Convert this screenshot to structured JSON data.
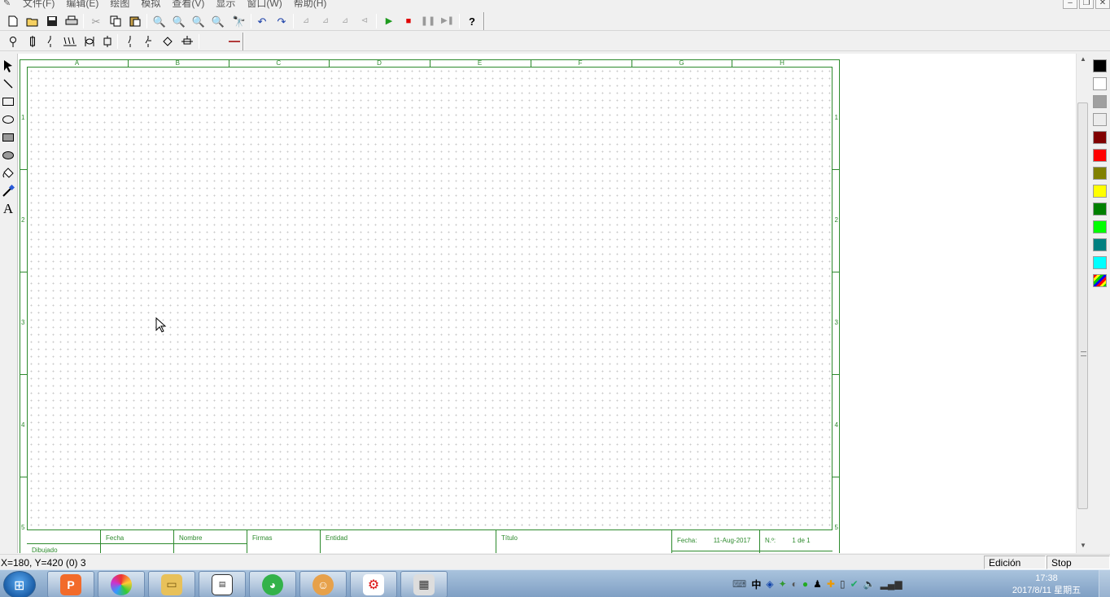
{
  "menubar": {
    "items": [
      "文件(F)",
      "编辑(E)",
      "绘图",
      "模拟",
      "查看(V)",
      "显示",
      "窗口(W)",
      "帮助(H)"
    ]
  },
  "toolbar1": {
    "icons": [
      "new-file-icon",
      "open-folder-icon",
      "save-icon",
      "print-icon",
      "cut-icon",
      "copy-icon",
      "paste-icon",
      "zoom-icon",
      "zoom-out-icon",
      "zoom-area-icon",
      "zoom-fit-icon",
      "find-icon",
      "undo-icon",
      "redo-icon",
      "mirror-h-icon",
      "mirror-v-icon",
      "rotate-left-icon",
      "rotate-right-icon",
      "run-icon",
      "stop-icon",
      "pause-icon",
      "step-icon",
      "help-icon"
    ]
  },
  "toolbar2": {
    "icons": [
      "lamp-icon",
      "fuse-icon",
      "switch-icon",
      "coil-icon",
      "transformer-icon",
      "relay-icon",
      "contact-no-icon",
      "contact-nc-icon",
      "node-icon",
      "terminal-icon",
      "line-color-icon"
    ]
  },
  "palette": {
    "tools": [
      "select-arrow-icon",
      "line-tool-icon",
      "rectangle-tool-icon",
      "ellipse-tool-icon",
      "filled-rectangle-tool-icon",
      "filled-ellipse-tool-icon",
      "fill-bucket-icon",
      "color-picker-icon",
      "text-tool-icon"
    ],
    "text_tool_glyph": "A"
  },
  "sheet": {
    "columns": [
      "A",
      "B",
      "C",
      "D",
      "E",
      "F",
      "G",
      "H"
    ],
    "rows": [
      "1",
      "2",
      "3",
      "4",
      "5"
    ],
    "titleblock": {
      "fecha_col": "Fecha",
      "nombre_col": "Nombre",
      "firmas": "Firmas",
      "entidad": "Entidad",
      "titulo": "Título",
      "fecha_label": "Fecha:",
      "fecha_value": "11-Aug-2017",
      "numero_label": "N.º:",
      "numero_value": "1 de 1",
      "dibujado": "Dibujado"
    }
  },
  "colors": {
    "swatches": [
      "#000000",
      "#ffffff",
      "#a0a0a0",
      "#ececec",
      "#800000",
      "#ff0000",
      "#808000",
      "#ffff00",
      "#008000",
      "#00ff00",
      "#008080",
      "#00ffff",
      "custom"
    ]
  },
  "statusbar": {
    "coords": "X=180, Y=420 (0) 3",
    "mode": "Edición",
    "sim_state": "Stop"
  },
  "taskbar": {
    "apps": [
      "wps-presentation",
      "photos",
      "file-explorer",
      "document-viewer",
      "wechat",
      "game",
      "cade-simu",
      "video-tool"
    ],
    "tray_ime": "中",
    "time": "17:38",
    "date": "2017/8/11 星期五"
  }
}
